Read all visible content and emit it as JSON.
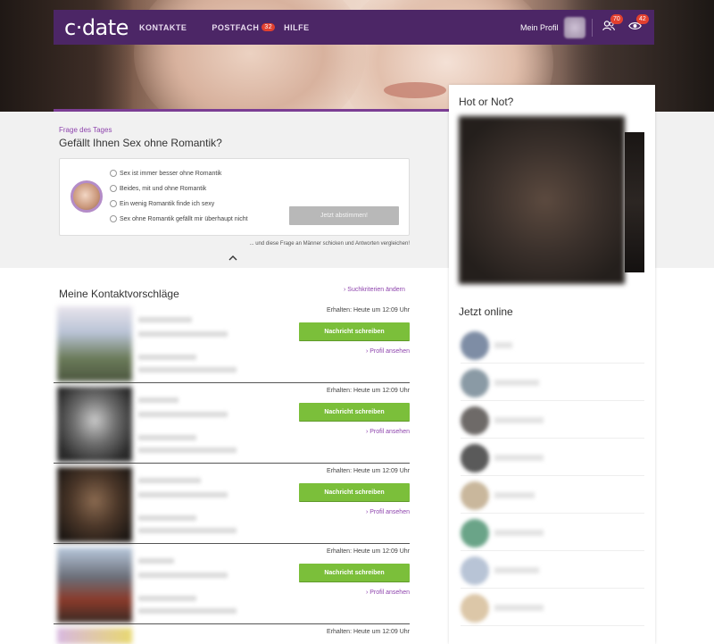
{
  "nav": {
    "logo": "c·date",
    "items": [
      {
        "label": "KONTAKTE"
      },
      {
        "label": "POSTFACH",
        "badge": "32"
      },
      {
        "label": "HILFE"
      }
    ],
    "profile_label": "Mein Profil",
    "contacts_badge": "70",
    "visitors_badge": "42"
  },
  "question": {
    "label": "Frage des Tages",
    "title": "Gefällt Ihnen Sex ohne Romantik?",
    "options": [
      "Sex ist immer besser ohne Romantik",
      "Beides, mit und ohne Romantik",
      "Ein wenig Romantik finde ich sexy",
      "Sex ohne Romantik gefällt mir überhaupt nicht"
    ],
    "vote_button": "Jetzt abstimmen!",
    "compare_text": "... und diese Frage an Männer schicken und Antworten vergleichen!"
  },
  "hot_or_not": {
    "title": "Hot or Not?"
  },
  "online": {
    "title": "Jetzt online"
  },
  "suggestions": {
    "title": "Meine Kontaktvorschläge",
    "search_link": "Suchkriterien ändern",
    "cards": [
      {
        "received": "Erhalten: Heute um 12:09 Uhr",
        "button": "Nachricht schreiben",
        "profile_link": "Profil ansehen"
      },
      {
        "received": "Erhalten: Heute um 12:09 Uhr",
        "button": "Nachricht schreiben",
        "profile_link": "Profil ansehen"
      },
      {
        "received": "Erhalten: Heute um 12:09 Uhr",
        "button": "Nachricht schreiben",
        "profile_link": "Profil ansehen"
      },
      {
        "received": "Erhalten: Heute um 12:09 Uhr",
        "button": "Nachricht schreiben",
        "profile_link": "Profil ansehen"
      },
      {
        "received": "Erhalten: Heute um 12:09 Uhr"
      }
    ]
  },
  "colors": {
    "brand_purple": "#4c2666",
    "accent_purple": "#8e44ad",
    "cta_green": "#7bbf3a",
    "badge_red": "#e2402f"
  }
}
